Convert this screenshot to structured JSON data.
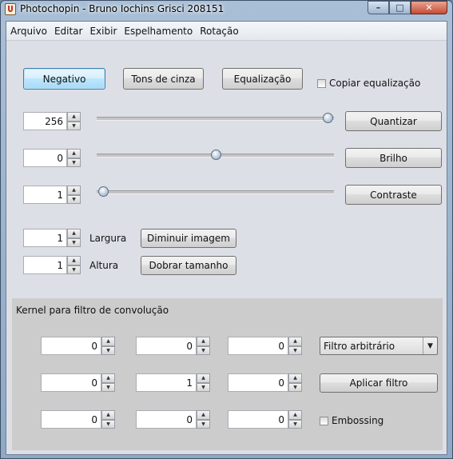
{
  "window": {
    "title": "Photochopin - Bruno Iochins Grisci 208151",
    "minimize": "–",
    "maximize": "□",
    "close": "✕"
  },
  "menubar": [
    "Arquivo",
    "Editar",
    "Exibir",
    "Espelhamento",
    "Rotação"
  ],
  "buttons": {
    "negativo": "Negativo",
    "tons_de_cinza": "Tons de cinza",
    "equalizacao": "Equalização",
    "quantizar": "Quantizar",
    "brilho": "Brilho",
    "contraste": "Contraste",
    "diminuir": "Diminuir imagem",
    "dobrar": "Dobrar tamanho",
    "aplicar_filtro": "Aplicar filtro"
  },
  "checkboxes": {
    "copiar_equalizacao": {
      "label": "Copiar equalização",
      "checked": false
    },
    "embossing": {
      "label": "Embossing",
      "checked": false
    }
  },
  "spinners": {
    "quantizar": "256",
    "brilho": "0",
    "contraste": "1",
    "largura": "1",
    "altura": "1"
  },
  "sliders": {
    "quantizar": {
      "min": 1,
      "max": 256,
      "value": 256
    },
    "brilho": {
      "min": -255,
      "max": 255,
      "value": 0
    },
    "contraste": {
      "min": 1,
      "max": 255,
      "value": 1
    }
  },
  "labels": {
    "largura": "Largura",
    "altura": "Altura"
  },
  "kernel": {
    "title": "Kernel para filtro de convolução",
    "rows": [
      [
        "0",
        "0",
        "0"
      ],
      [
        "0",
        "1",
        "0"
      ],
      [
        "0",
        "0",
        "0"
      ]
    ],
    "filter_select": "Filtro arbitrário"
  },
  "icons": {
    "spin_up": "▲",
    "spin_down": "▼",
    "dropdown": "▼"
  },
  "colors": {
    "focus_border": "#3c7fb1",
    "panel_bg": "#dddfe6",
    "kernel_bg": "#cccccc"
  }
}
